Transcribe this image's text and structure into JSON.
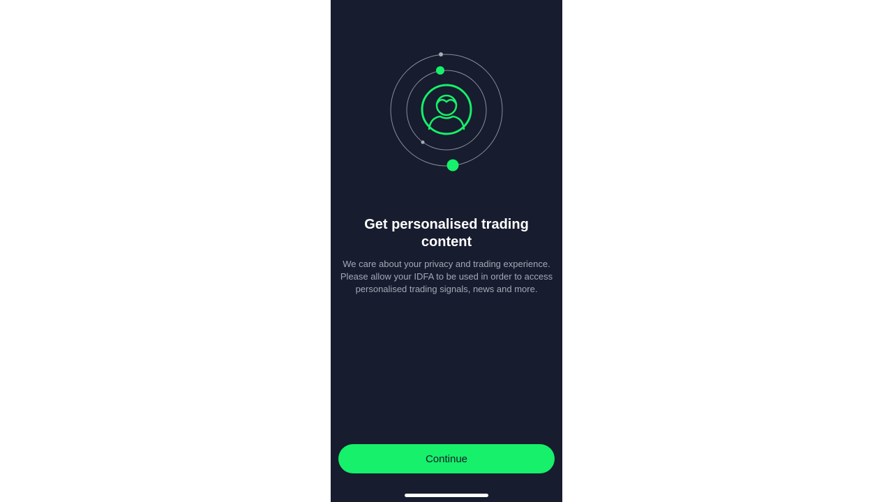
{
  "onboarding": {
    "title": "Get personalised trading content",
    "description": "We care about your privacy and trading experience. Please allow your IDFA to be used in order to access personalised trading signals, news and more.",
    "continue_label": "Continue"
  },
  "illustration": {
    "icon": "user-profile-icon",
    "accent_color": "#16f06a",
    "orbit_color": "#8a8f9c"
  },
  "colors": {
    "background": "#171c2e",
    "accent": "#16f06a",
    "title_text": "#ffffff",
    "body_text": "#a4a9b7"
  }
}
